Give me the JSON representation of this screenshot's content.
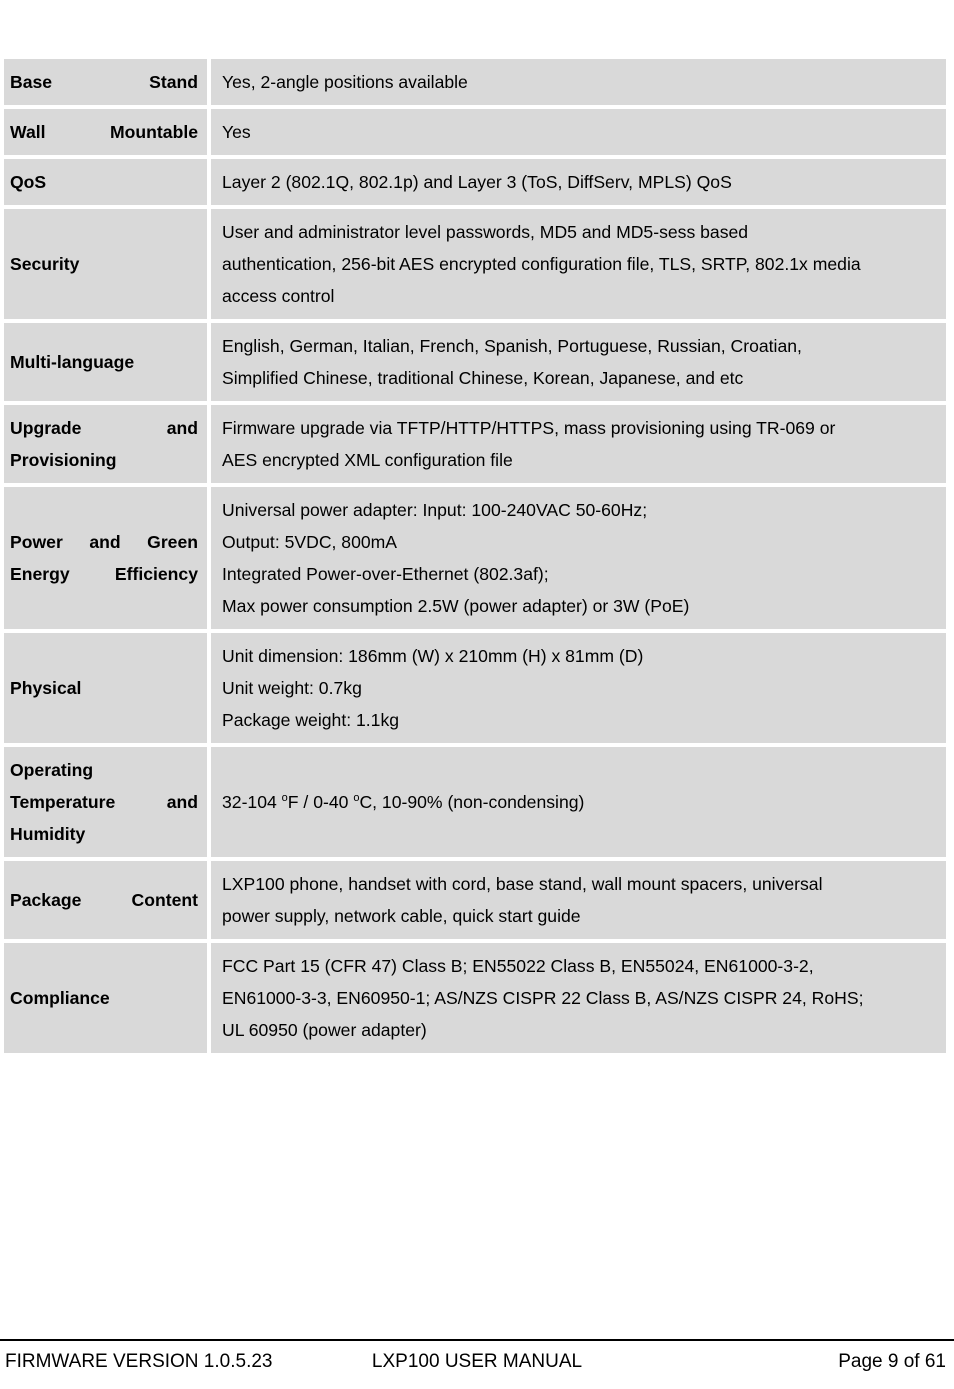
{
  "document": {
    "title": "LXP100 USER MANUAL",
    "section": "Technical specifications table"
  },
  "table": {
    "rows": [
      {
        "label": "Base Stand",
        "lines": [
          "Yes, 2-angle positions available"
        ]
      },
      {
        "label": "Wall Mountable",
        "lines": [
          "Yes"
        ]
      },
      {
        "label": "QoS",
        "lines": [
          "Layer 2 (802.1Q, 802.1p) and Layer 3 (ToS, DiffServ, MPLS) QoS"
        ]
      },
      {
        "label": "Security",
        "justified": true,
        "lines": [
          "User and administrator level passwords, MD5 and MD5-sess based",
          "authentication, 256-bit AES encrypted configuration file, TLS, SRTP, 802.1x media",
          "access control"
        ]
      },
      {
        "label": "Multi-language",
        "justified": true,
        "lines": [
          "English, German, Italian, French, Spanish, Portuguese, Russian, Croatian,",
          "Simplified Chinese, traditional Chinese, Korean, Japanese, and etc"
        ]
      },
      {
        "label": "Upgrade and Provisioning",
        "justified": true,
        "lines": [
          "Firmware upgrade via TFTP/HTTP/HTTPS, mass provisioning using TR-069 or",
          "AES encrypted XML configuration file"
        ]
      },
      {
        "label": "Power and Green Energy Efficiency",
        "lines": [
          "Universal power adapter: Input: 100-240VAC 50-60Hz;",
          "Output: 5VDC, 800mA",
          "Integrated Power-over-Ethernet (802.3af);",
          "Max power consumption 2.5W (power adapter) or 3W (PoE)"
        ]
      },
      {
        "label": "Physical",
        "lines": [
          "Unit dimension: 186mm (W) x 210mm (H) x 81mm (D)",
          "Unit weight: 0.7kg",
          "Package weight: 1.1kg"
        ]
      },
      {
        "label": "Operating Temperature and Humidity",
        "temperature": {
          "prefix": "32-104 ",
          "degree": "o",
          "fahrenheit": "F / 0-40 ",
          "celsius": "C, 10-90% (non-condensing)"
        },
        "lines": [
          "32-104 oF / 0-40 oC, 10-90% (non-condensing)"
        ]
      },
      {
        "label": "Package Content",
        "justified": true,
        "lines": [
          "LXP100 phone, handset with cord, base stand, wall mount spacers, universal",
          "power supply, network cable, quick start guide"
        ]
      },
      {
        "label": "Compliance",
        "justified": true,
        "lines": [
          "FCC Part 15 (CFR 47) Class B; EN55022 Class B, EN55024, EN61000-3-2,",
          "EN61000-3-3, EN60950-1; AS/NZS CISPR 22 Class B, AS/NZS CISPR 24, RoHS;",
          "UL 60950 (power adapter)"
        ]
      }
    ]
  },
  "footer": {
    "firmware": "FIRMWARE VERSION 1.0.5.23",
    "manual": "LXP100 USER MANUAL",
    "page": "Page 9 of 61"
  },
  "colors": {
    "cell_background": "#d9d9d9",
    "page_background": "#ffffff",
    "text": "#000000"
  }
}
